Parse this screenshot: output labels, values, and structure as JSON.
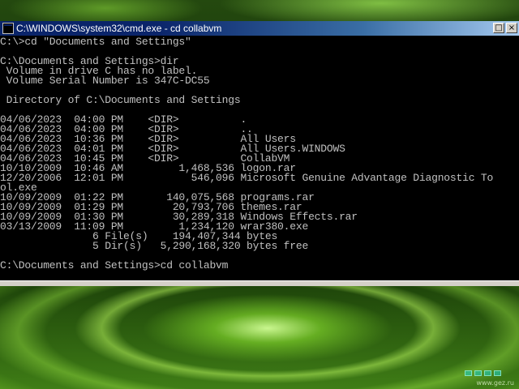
{
  "window": {
    "title": "C:\\WINDOWS\\system32\\cmd.exe - cd collabvm",
    "buttons": [
      "□",
      "×"
    ]
  },
  "console_lines": [
    "C:\\>cd \"Documents and Settings\"",
    "",
    "C:\\Documents and Settings>dir",
    " Volume in drive C has no label.",
    " Volume Serial Number is 347C-DC55",
    "",
    " Directory of C:\\Documents and Settings",
    "",
    "04/06/2023  04:00 PM    <DIR>          .",
    "04/06/2023  04:00 PM    <DIR>          ..",
    "04/06/2023  10:36 PM    <DIR>          All Users",
    "04/06/2023  04:01 PM    <DIR>          All Users.WINDOWS",
    "04/06/2023  10:45 PM    <DIR>          CollabVM",
    "10/10/2009  10:46 AM         1,468,536 logon.rar",
    "12/20/2006  12:01 PM           546,096 Microsoft Genuine Advantage Diagnostic To",
    "ol.exe",
    "10/09/2009  01:22 PM       140,075,568 programs.rar",
    "10/09/2009  01:29 PM        20,793,706 themes.rar",
    "10/09/2009  01:30 PM        30,289,318 Windows Effects.rar",
    "03/13/2009  11:09 PM         1,234,120 wrar380.exe",
    "               6 File(s)    194,407,344 bytes",
    "               5 Dir(s)   5,290,168,320 bytes free",
    "",
    "C:\\Documents and Settings>cd collabvm"
  ],
  "desktop": {
    "watermark": "www.gez.ru"
  },
  "colors": {
    "console_bg": "#000000",
    "console_text": "#c0c0c0",
    "titlebar_start": "#0a246a",
    "titlebar_end": "#a6caf0"
  }
}
